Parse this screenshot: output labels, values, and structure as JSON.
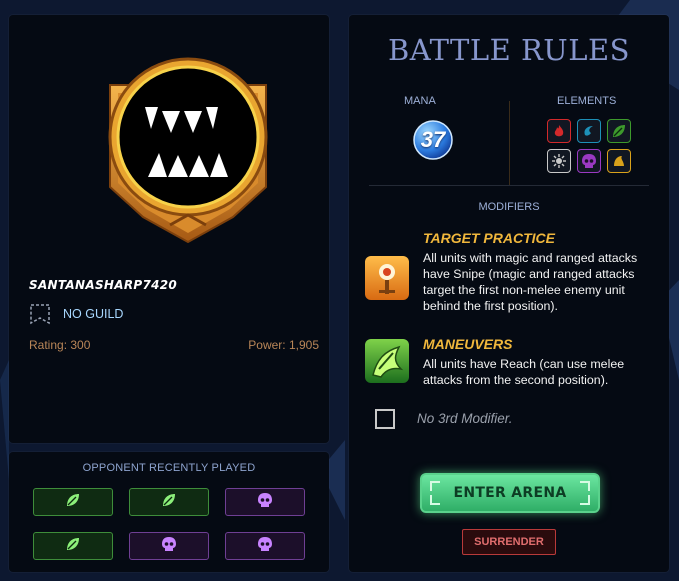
{
  "player": {
    "name": "SANTANASHARP7420",
    "guild": "NO GUILD",
    "rating": "Rating: 300",
    "power": "Power: 1,905",
    "badge_icon": "fangs-icon"
  },
  "opponent": {
    "title": "OPPONENT RECENTLY PLAYED",
    "splinters": [
      "earth",
      "earth",
      "death",
      "earth",
      "death",
      "death"
    ]
  },
  "battle_rules": {
    "title": "BATTLE RULES",
    "mana_label": "MANA",
    "mana": "37",
    "elements_label": "ELEMENTS",
    "elements": [
      {
        "name": "fire",
        "color": "#d3292b",
        "icon": "fire-icon"
      },
      {
        "name": "water",
        "color": "#1d90b7",
        "icon": "water-icon"
      },
      {
        "name": "earth",
        "color": "#3d9a2c",
        "icon": "leaf-icon"
      },
      {
        "name": "life",
        "color": "#c9c9c9",
        "icon": "sun-icon"
      },
      {
        "name": "death",
        "color": "#9a39c2",
        "icon": "skull-icon"
      },
      {
        "name": "dragon",
        "color": "#d9a21b",
        "icon": "dragon-icon"
      }
    ],
    "modifiers_label": "MODIFIERS",
    "modifiers": [
      {
        "title": "TARGET PRACTICE",
        "description": "All units with magic and ranged attacks have Snipe (magic and ranged attacks target the first non-melee enemy unit behind the first position).",
        "icon": "target-practice-icon"
      },
      {
        "title": "MANEUVERS",
        "description": "All units have Reach (can use melee attacks from the second position).",
        "icon": "maneuvers-icon"
      }
    ],
    "empty_modifier": "No 3rd Modifier."
  },
  "actions": {
    "enter_arena": "ENTER ARENA",
    "surrender": "SURRENDER"
  },
  "colors": {
    "accent_gold": "#f0b73c",
    "title_blue": "#8796cc",
    "enter_green": "#4fd184",
    "surrender_red": "#b93a3a"
  }
}
